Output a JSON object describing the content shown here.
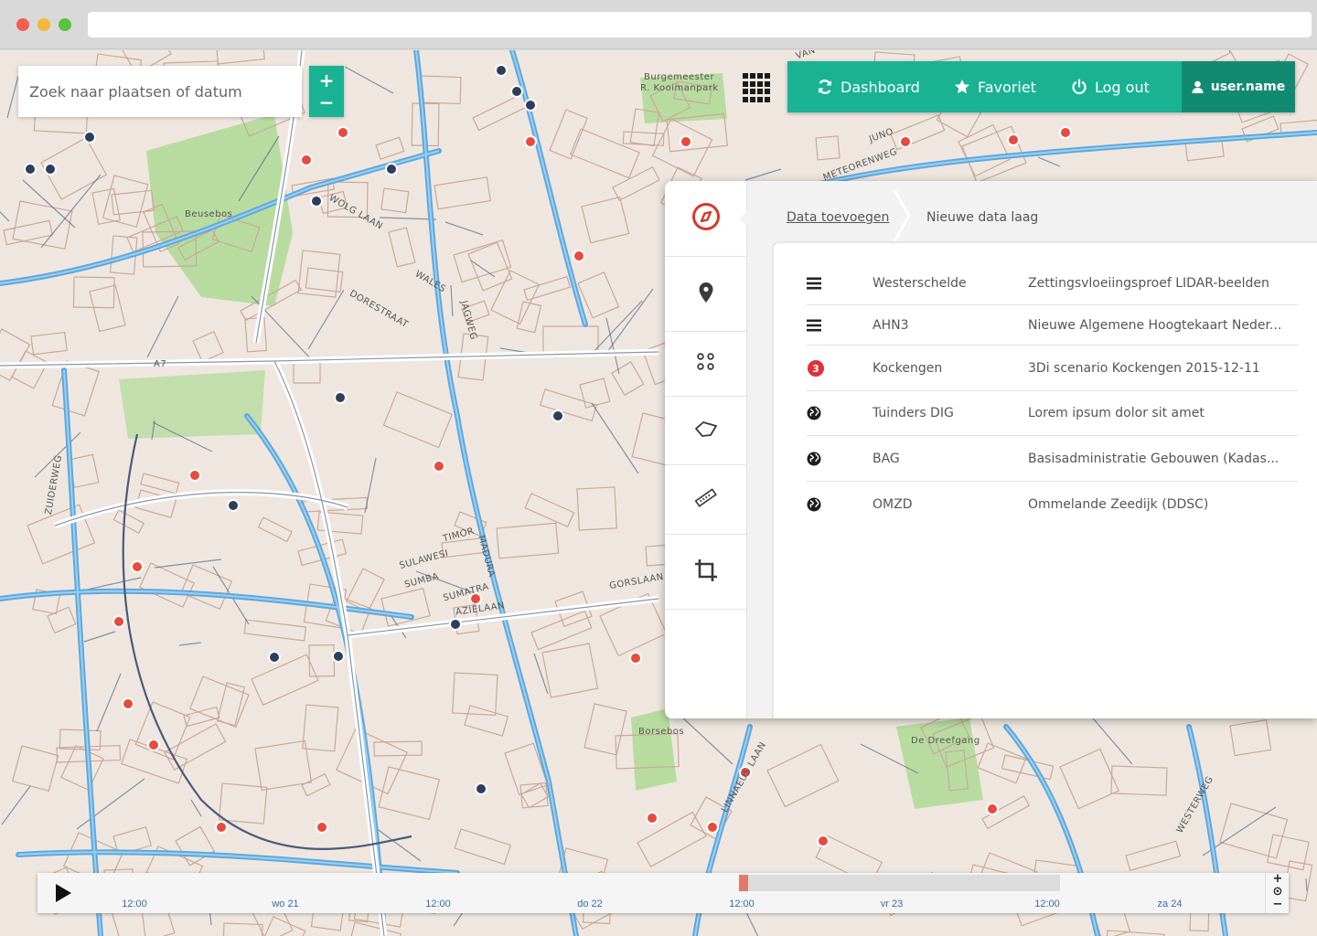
{
  "search": {
    "placeholder": "Zoek naar plaatsen of datum"
  },
  "zoom": {
    "in_label": "+",
    "out_label": "−"
  },
  "nav": {
    "dashboard": "Dashboard",
    "favoriet": "Favoriet",
    "logout": "Log out",
    "user": "user.name"
  },
  "map_labels": {
    "park1": "Burgemeester",
    "park2": "R. Kooimanpark",
    "beusebos": "Beusebos",
    "a7": "A7",
    "zuiderweg": "ZUIDERWEG",
    "wolg_laan": "WOLG LAAN",
    "wales": "WALES",
    "jagweg": "JAGWEG",
    "gorslaan": "GORSLAAN",
    "azielaan": "AZIËLAAN",
    "borsebos": "Borsebos",
    "de_dreef": "De Dreefgang",
    "juno": "JUNO",
    "meteorenweg": "METEORENWEG",
    "van": "VAN",
    "westerweg": "WESTERWEG",
    "sulawesi": "SULAWESI",
    "sumba": "SUMBA",
    "sumatra": "SUMATRA",
    "timor": "TIMOR",
    "madura": "MADURA",
    "dorestraat": "DORESTRAAT",
    "linnaeuslaan": "LINNAEUS LAAN"
  },
  "panel": {
    "breadcrumb_link": "Data toevoegen",
    "breadcrumb_current": "Nieuwe data laag",
    "tools": [
      "compass-icon",
      "map-pin-icon",
      "points-icon",
      "polygon-icon",
      "ruler-icon",
      "crop-icon"
    ],
    "rows": [
      {
        "icon": "hamburger-icon",
        "name": "Westerschelde",
        "desc": "Zettingsvloeiingsproef LIDAR-beelden"
      },
      {
        "icon": "hamburger-icon",
        "name": "AHN3",
        "desc": "Nieuwe Algemene Hoogtekaart Neder..."
      },
      {
        "icon": "threedi-icon",
        "name": "Kockengen",
        "desc": "3Di scenario Kockengen 2015-12-11"
      },
      {
        "icon": "globe-icon",
        "name": "Tuinders DIG",
        "desc": "Lorem ipsum dolor sit amet"
      },
      {
        "icon": "globe-icon",
        "name": "BAG",
        "desc": "Basisadministratie Gebouwen (Kadas..."
      },
      {
        "icon": "globe-icon",
        "name": "OMZD",
        "desc": "Ommelande Zeedijk (DDSC)"
      }
    ]
  },
  "timeline": {
    "ticks": [
      "12:00",
      "wo 21",
      "12:00",
      "do 22",
      "12:00",
      "vr 23",
      "12:00",
      "za 24"
    ],
    "zoom_in": "+",
    "reset": "⊙",
    "zoom_out": "−"
  },
  "colors": {
    "accent": "#19b394",
    "accent_dark": "#128a72",
    "water": "#5fa8dc",
    "building": "#c9a89a",
    "park": "#b8dca0",
    "red_marker": "#e84a3c"
  }
}
